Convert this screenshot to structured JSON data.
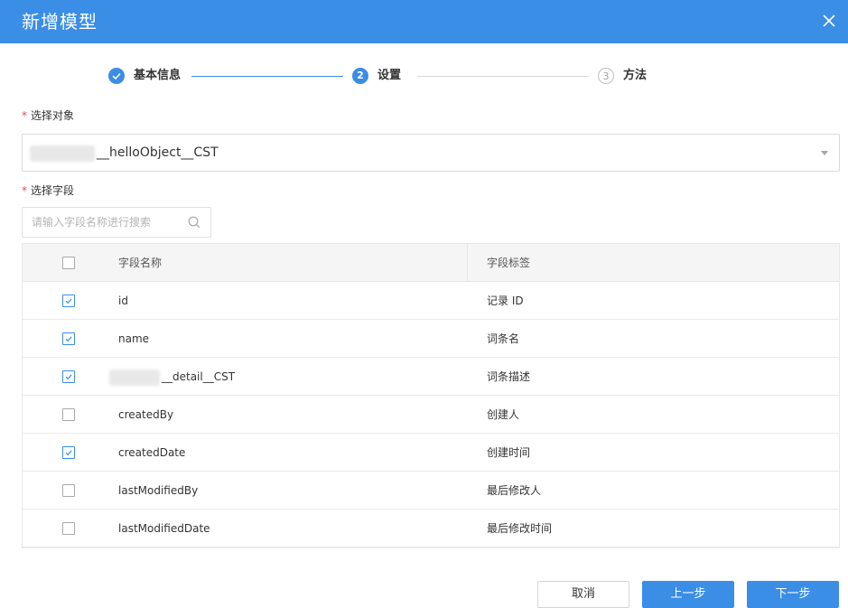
{
  "dialog": {
    "title": "新增模型",
    "close_icon": "close-icon"
  },
  "steps": [
    {
      "label": "基本信息",
      "state": "done",
      "icon": "check-icon"
    },
    {
      "label": "设置",
      "state": "active",
      "number": "2"
    },
    {
      "label": "方法",
      "state": "pending",
      "number": "3"
    }
  ],
  "object_field": {
    "label": "选择对象",
    "required_mark": "*",
    "value": "__helloObject__CST"
  },
  "fields_field": {
    "label": "选择字段",
    "required_mark": "*",
    "search_placeholder": "请输入字段名称进行搜索",
    "search_icon": "search-icon"
  },
  "table": {
    "columns": [
      "字段名称",
      "字段标签"
    ],
    "rows": [
      {
        "name": "id",
        "label": "记录 ID",
        "checked": true
      },
      {
        "name": "name",
        "label": "词条名",
        "checked": true
      },
      {
        "name": "__detail__CST",
        "label": "词条描述",
        "checked": true
      },
      {
        "name": "createdBy",
        "label": "创建人",
        "checked": false
      },
      {
        "name": "createdDate",
        "label": "创建时间",
        "checked": true
      },
      {
        "name": "lastModifiedBy",
        "label": "最后修改人",
        "checked": false
      },
      {
        "name": "lastModifiedDate",
        "label": "最后修改时间",
        "checked": false
      }
    ]
  },
  "buttons": {
    "cancel": "取消",
    "prev": "上一步",
    "next": "下一步"
  },
  "colors": {
    "primary": "#3a8ee6",
    "required": "#e5484d"
  }
}
